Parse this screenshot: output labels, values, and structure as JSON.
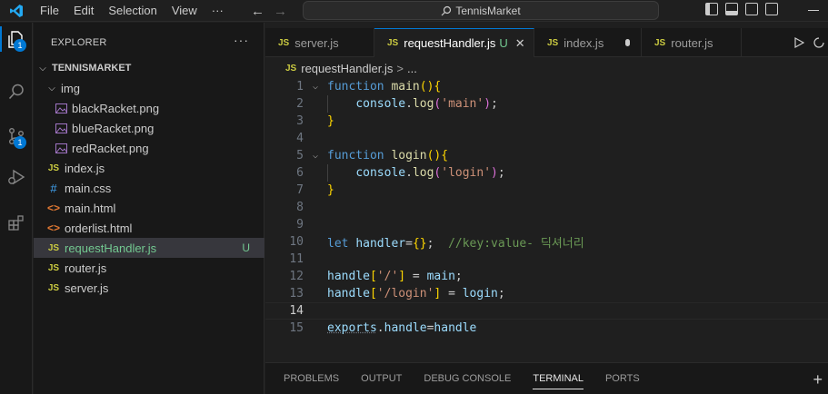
{
  "menu": [
    "File",
    "Edit",
    "Selection",
    "View",
    "···"
  ],
  "search": {
    "label": "TennisMarket"
  },
  "activity": {
    "explorer_badge": "1",
    "scm_badge": "1"
  },
  "sidebar": {
    "header": "EXPLORER",
    "more": "···",
    "root": "TENNISMARKET",
    "items": [
      {
        "label": "img",
        "type": "folder"
      },
      {
        "label": "blackRacket.png",
        "type": "png"
      },
      {
        "label": "blueRacket.png",
        "type": "png"
      },
      {
        "label": "redRacket.png",
        "type": "png"
      },
      {
        "label": "index.js",
        "type": "js"
      },
      {
        "label": "main.css",
        "type": "css"
      },
      {
        "label": "main.html",
        "type": "html"
      },
      {
        "label": "orderlist.html",
        "type": "html"
      },
      {
        "label": "requestHandler.js",
        "type": "js",
        "status": "U"
      },
      {
        "label": "router.js",
        "type": "js"
      },
      {
        "label": "server.js",
        "type": "js"
      }
    ],
    "icons": {
      "js": "JS",
      "css": "#",
      "html": "<>"
    }
  },
  "tabs": [
    {
      "label": "server.js"
    },
    {
      "label": "requestHandler.js",
      "status": "U"
    },
    {
      "label": "index.js"
    },
    {
      "label": "router.js"
    }
  ],
  "tab_icon": "JS",
  "breadcrumb": {
    "file": "requestHandler.js",
    "sep": ">",
    "more": "..."
  },
  "editor": {
    "current_line": 14,
    "line_numbers": [
      "1",
      "2",
      "3",
      "4",
      "5",
      "6",
      "7",
      "8",
      "9",
      "10",
      "11",
      "12",
      "13",
      "14",
      "15"
    ]
  },
  "panel": {
    "tabs": [
      "PROBLEMS",
      "OUTPUT",
      "DEBUG CONSOLE",
      "TERMINAL",
      "PORTS"
    ],
    "active": "TERMINAL"
  },
  "colors": {
    "accent": "#0078d4",
    "untracked": "#73c991"
  }
}
